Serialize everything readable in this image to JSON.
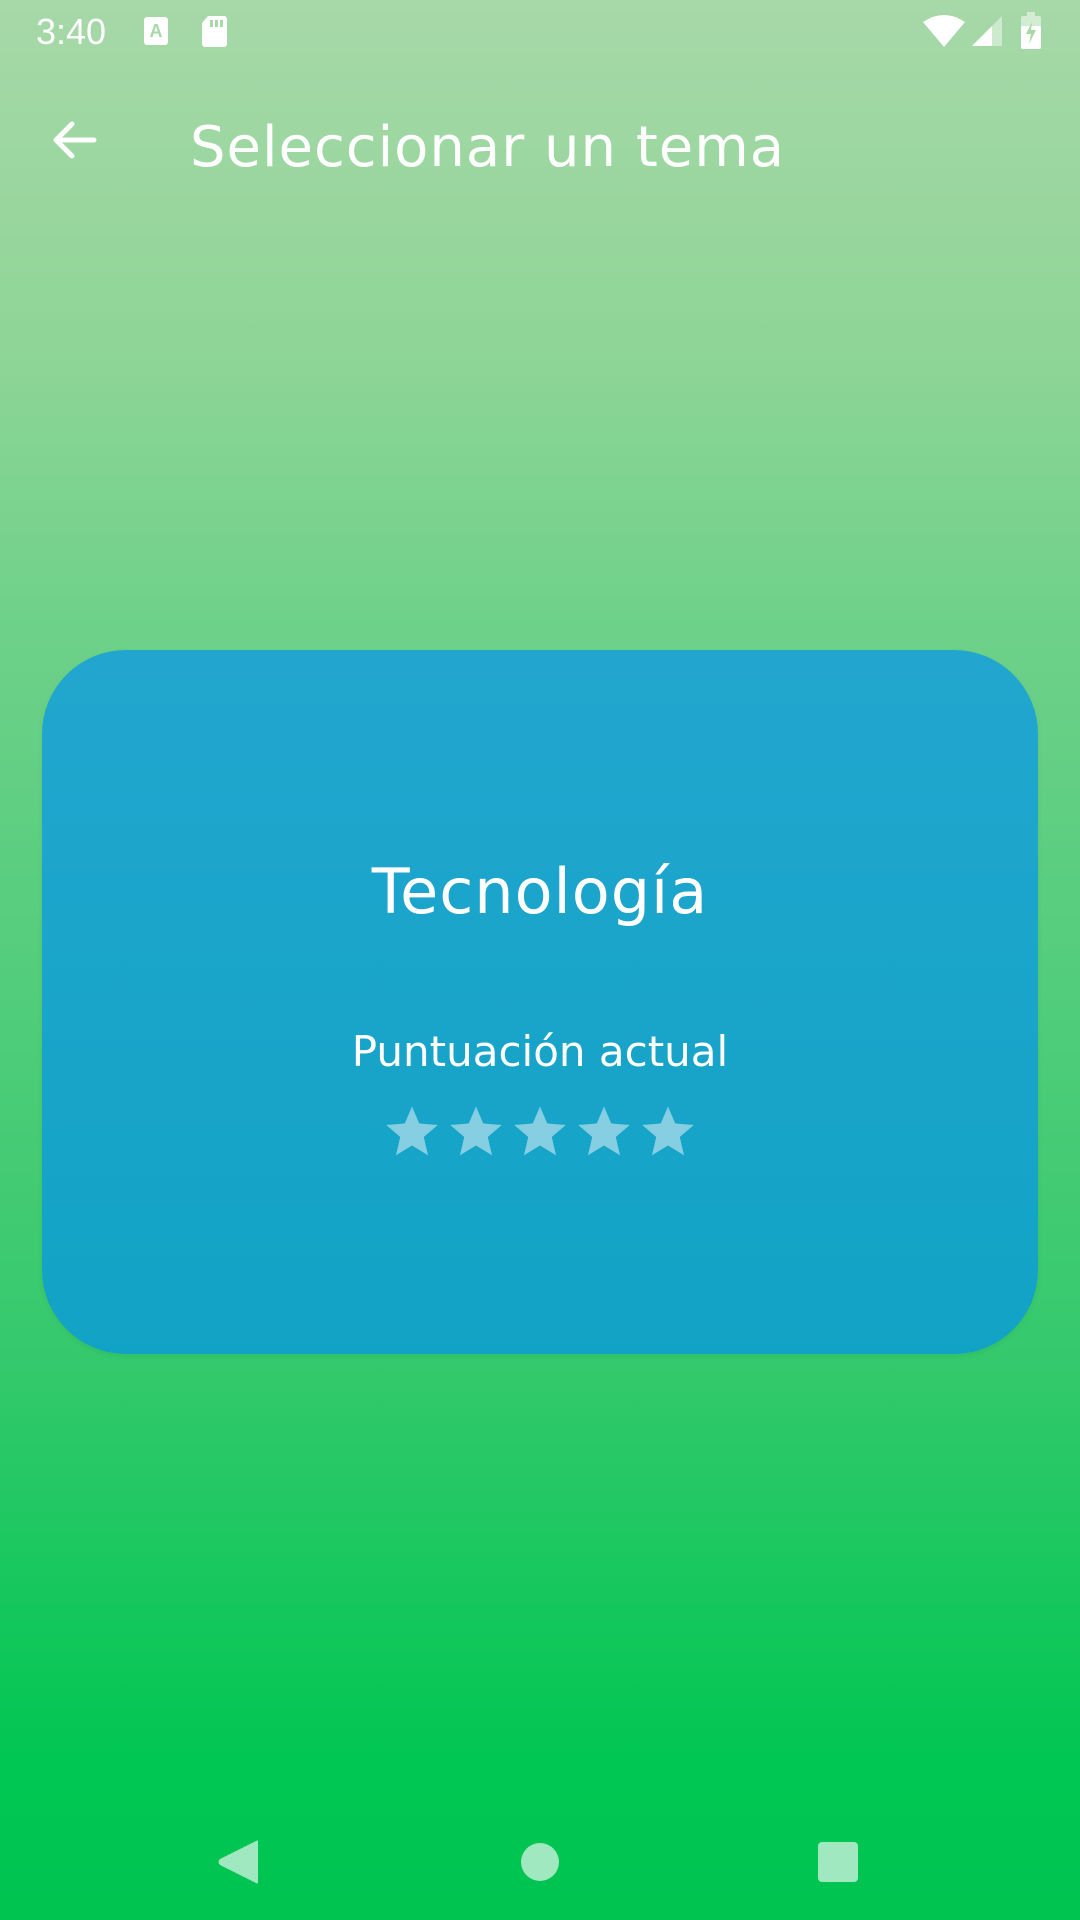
{
  "status_bar": {
    "time": "3:40",
    "icons": [
      "font-download-icon",
      "sd-card-icon",
      "wifi-icon",
      "signal-icon",
      "battery-charging-icon"
    ]
  },
  "app_bar": {
    "title": "Seleccionar un tema",
    "back_icon": "arrow-back-icon"
  },
  "topic_card": {
    "title": "Tecnología",
    "score_label": "Puntuación actual",
    "rating": {
      "filled": 0,
      "max": 5
    }
  },
  "nav_bar": {
    "buttons": [
      "back-nav",
      "home-nav",
      "recents-nav"
    ]
  },
  "colors": {
    "card_top": "#22a6cf",
    "card_bottom": "#11a3c5",
    "star_empty": "#86cfe3",
    "gradient_top": "#a7d8a8",
    "gradient_bottom": "#00c450",
    "nav_icon": "#a0e8bf"
  }
}
